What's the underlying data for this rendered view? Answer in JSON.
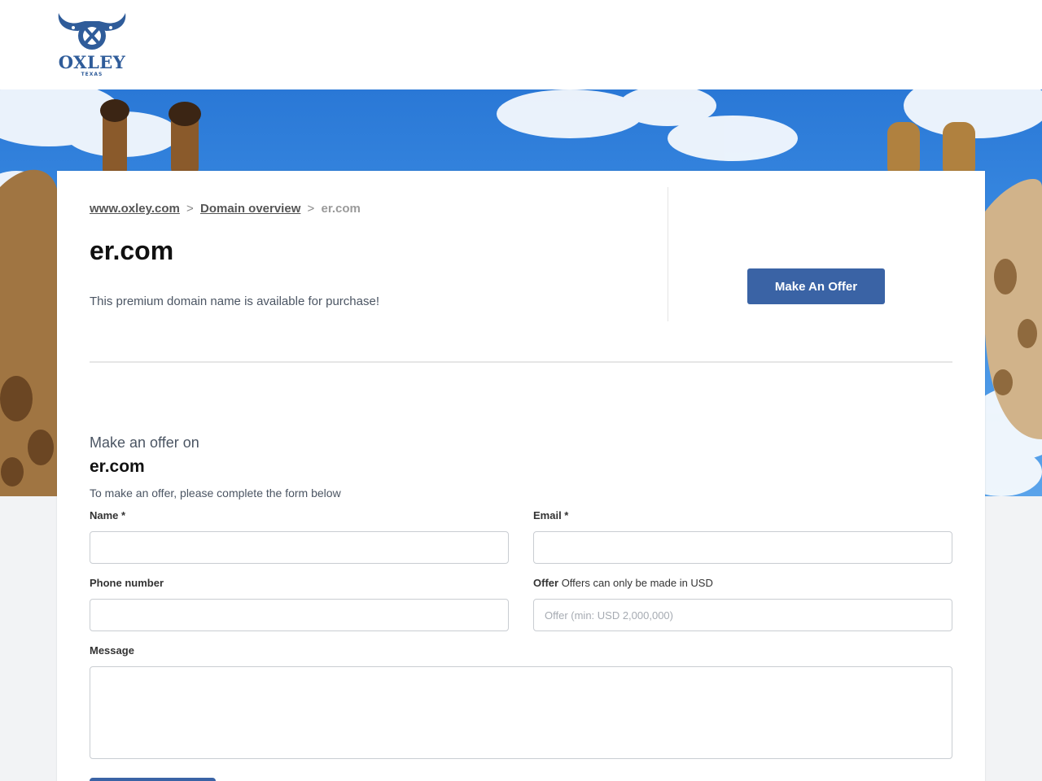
{
  "brand": {
    "logo_word": "OXLEY",
    "logo_sub": "TEXAS",
    "color": "#2f5c9a"
  },
  "breadcrumb": {
    "home": "www.oxley.com",
    "sep1": ">",
    "overview": "Domain overview",
    "sep2": ">",
    "current": "er.com"
  },
  "domain": {
    "name": "er.com",
    "availability": "This premium domain name is available for purchase!"
  },
  "cta": {
    "make_offer_label": "Make An Offer",
    "color": "#3a63a5"
  },
  "offer_form": {
    "heading": "Make an offer on",
    "domain": "er.com",
    "instructions": "To make an offer, please complete the form below",
    "name_label": "Name *",
    "email_label": "Email *",
    "phone_label": "Phone number",
    "offer_label": "Offer",
    "offer_note": "Offers can only be made in USD",
    "offer_placeholder": "Offer (min: USD 2,000,000)",
    "message_label": "Message"
  },
  "hero": {
    "sky_color": "#2a78d6",
    "cloud_color": "#ffffff",
    "giraffe_color": "#8a5a2b"
  }
}
